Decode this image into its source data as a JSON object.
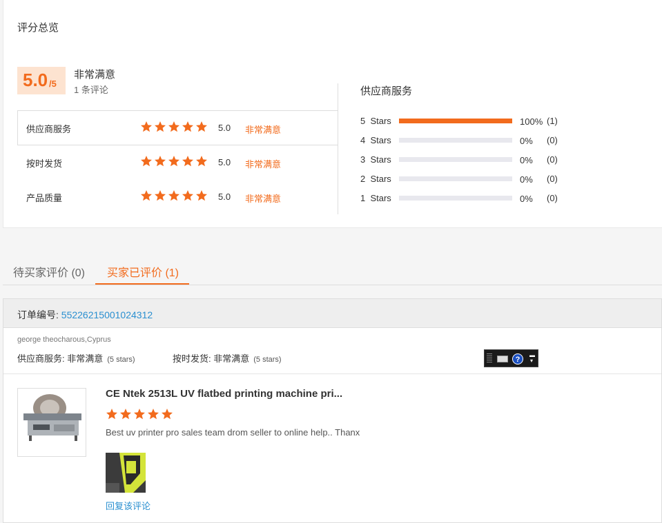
{
  "summary": {
    "title": "评分总览",
    "score": "5.0",
    "score_max": "/5",
    "satisfaction": "非常满意",
    "review_count": "1 条评论"
  },
  "rating_rows": [
    {
      "label": "供应商服务",
      "stars": 5,
      "score": "5.0",
      "sat": "非常满意"
    },
    {
      "label": "按时发货",
      "stars": 5,
      "score": "5.0",
      "sat": "非常满意"
    },
    {
      "label": "产品质量",
      "stars": 5,
      "score": "5.0",
      "sat": "非常满意"
    }
  ],
  "distribution": {
    "title": "供应商服务",
    "rows": [
      {
        "label": "5  Stars",
        "fraction": 1.0,
        "pct": "100%",
        "count": "(1)"
      },
      {
        "label": "4  Stars",
        "fraction": 0.0,
        "pct": "0%",
        "count": "(0)"
      },
      {
        "label": "3  Stars",
        "fraction": 0.0,
        "pct": "0%",
        "count": "(0)"
      },
      {
        "label": "2  Stars",
        "fraction": 0.0,
        "pct": "0%",
        "count": "(0)"
      },
      {
        "label": "1  Stars",
        "fraction": 0.0,
        "pct": "0%",
        "count": "(0)"
      }
    ]
  },
  "tabs": {
    "pending": "待买家评价 (0)",
    "reviewed": "买家已评价 (1)"
  },
  "order": {
    "label": "订单编号: ",
    "number": "55226215001024312",
    "buyer": "george theocharous,Cyprus",
    "supplier_label": "供应商服务: 非常满意",
    "supplier_stars": "(5 stars)",
    "delivery_label": "按时发货: 非常满意",
    "delivery_stars": "(5 stars)",
    "product_title": "CE Ntek 2513L UV flatbed printing machine pri...",
    "product_stars": 5,
    "review_text": "Best uv printer pro sales team drom seller to online help.. Thanx",
    "reply_label": "回复该评论"
  },
  "colors": {
    "accent": "#f26b1d",
    "link": "#2a8fd0",
    "score_bg": "#fde3d0"
  }
}
